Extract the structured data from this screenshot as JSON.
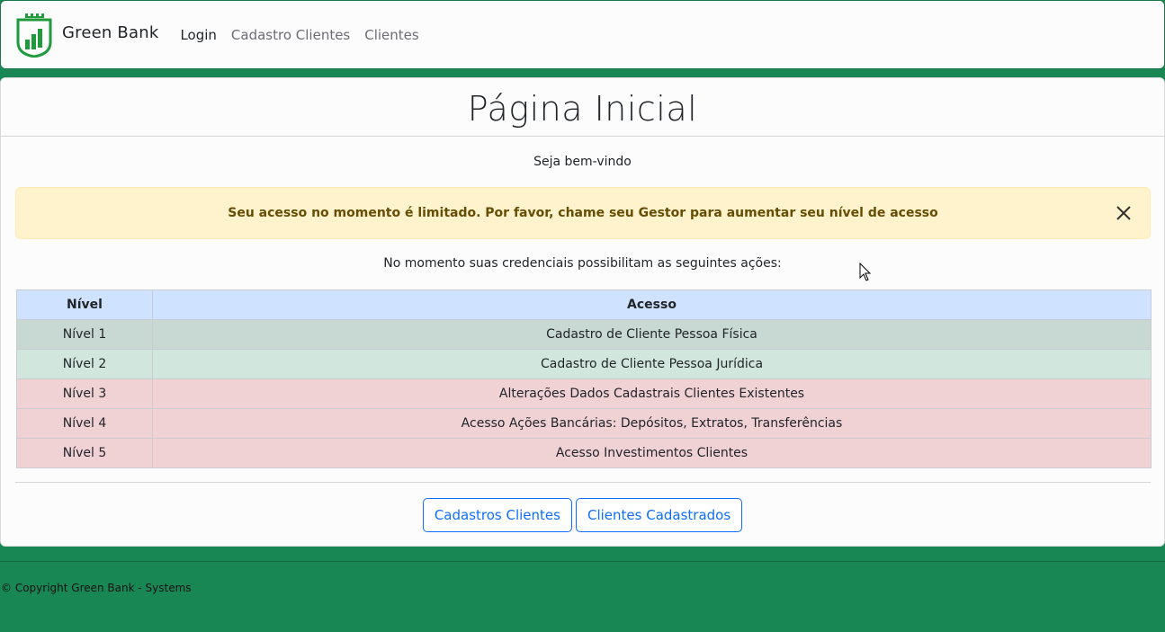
{
  "navbar": {
    "brand_name": "Green Bank",
    "links": [
      {
        "label": "Login",
        "active": true
      },
      {
        "label": "Cadastro Clientes",
        "active": false
      },
      {
        "label": "Clientes",
        "active": false
      }
    ]
  },
  "main": {
    "title": "Página Inicial",
    "welcome": "Seja bem-vindo",
    "alert": {
      "message": "Seu acesso no momento é limitado. Por favor, chame seu Gestor para aumentar seu nível de acesso"
    },
    "subtext": "No momento suas credenciais possibilitam as seguintes ações:",
    "table": {
      "headers": [
        "Nível",
        "Acesso"
      ],
      "rows": [
        [
          "Nível 1",
          "Cadastro de Cliente Pessoa Física"
        ],
        [
          "Nível 2",
          "Cadastro de Cliente Pessoa Jurídica"
        ],
        [
          "Nível 3",
          "Alterações Dados Cadastrais Clientes Existentes"
        ],
        [
          "Nível 4",
          "Acesso Ações Bancárias: Depósitos, Extratos, Transferências"
        ],
        [
          "Nível 5",
          "Acesso Investimentos Clientes"
        ]
      ]
    },
    "buttons": {
      "cadastros_clientes": "Cadastros Clientes",
      "clientes_cadastrados": "Clientes Cadastrados"
    }
  },
  "footer": {
    "copyright": "© Copyright Green Bank - Systems"
  },
  "colors": {
    "brand_green": "#198754",
    "alert_bg": "#fff3cd",
    "table_header": "#cfe2ff",
    "row_success": "#d1e7dd",
    "row_danger": "#f0d2d5",
    "button_primary": "#0d6efd"
  },
  "icons": {
    "brand_logo": "green-bank-logo-icon",
    "alert_close": "close-icon",
    "cursor": "mouse-pointer-icon"
  }
}
